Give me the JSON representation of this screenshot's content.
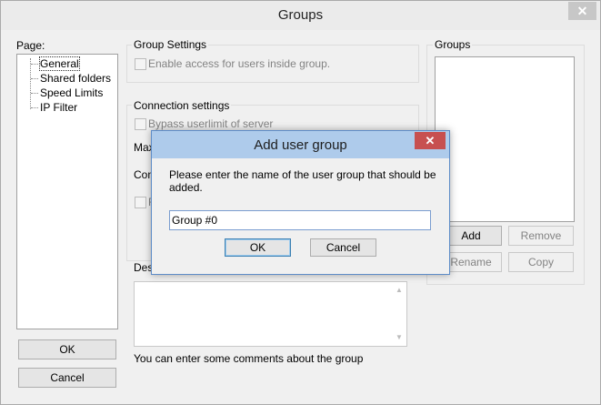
{
  "window": {
    "title": "Groups",
    "close_glyph": "✕"
  },
  "page_panel": {
    "label": "Page:",
    "items": [
      "General",
      "Shared folders",
      "Speed Limits",
      "IP Filter"
    ],
    "selected": "General"
  },
  "group_settings": {
    "title": "Group Settings",
    "enable_access_label": "Enable access for users inside group."
  },
  "connection_settings": {
    "title": "Connection settings",
    "bypass_label": "Bypass userlimit of server",
    "max_label_partial": "Max",
    "conn_label_partial": "Con",
    "f_label_partial": "F"
  },
  "description": {
    "label_partial": "Desc",
    "hint": "You can enter some comments about the group"
  },
  "groups_panel": {
    "title": "Groups",
    "add_label": "Add",
    "remove_label": "Remove",
    "rename_label": "Rename",
    "copy_label": "Copy"
  },
  "footer": {
    "ok_label": "OK",
    "cancel_label": "Cancel"
  },
  "dialog": {
    "title": "Add user group",
    "close_glyph": "✕",
    "prompt_line1": "Please enter the name of the user group that should be",
    "prompt_line2": "added.",
    "input_value": "Group #0",
    "ok_label": "OK",
    "cancel_label": "Cancel"
  },
  "colors": {
    "dialog_titlebar": "#aecbeb",
    "dialog_close": "#c75050",
    "window_close": "#c7c7c7"
  }
}
